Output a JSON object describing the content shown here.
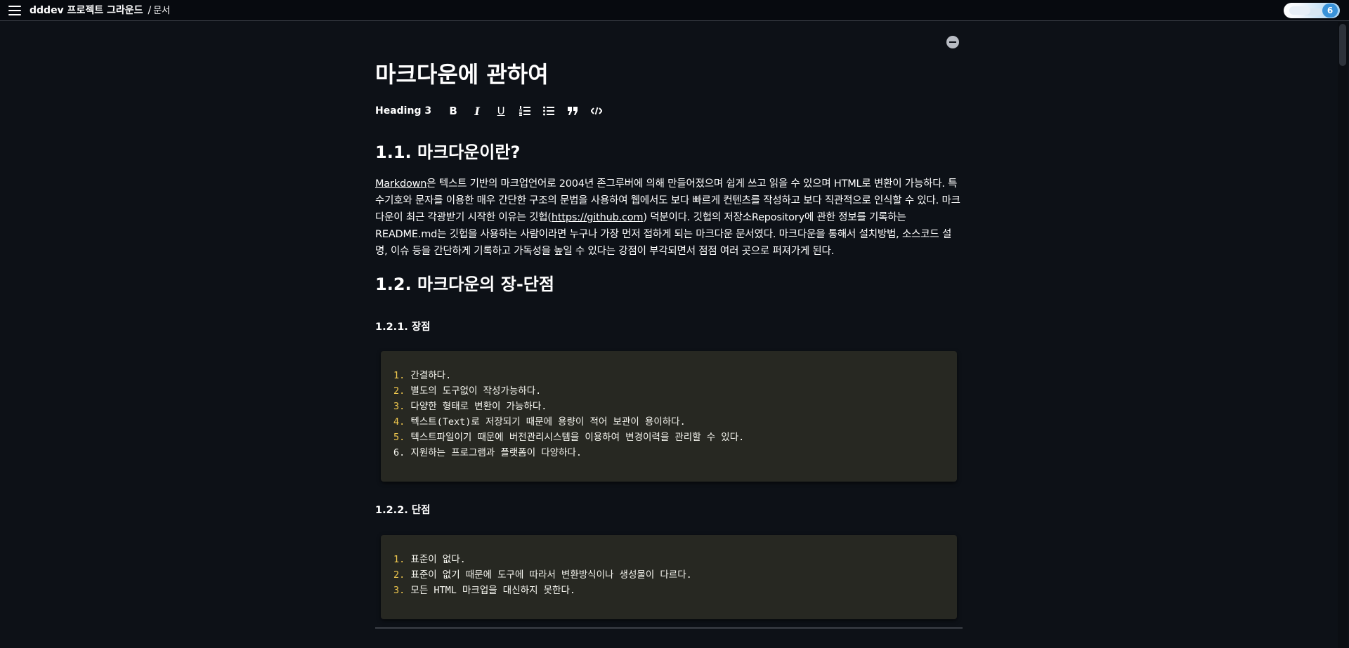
{
  "header": {
    "project": "dddev 프로젝트 그라운드",
    "separator": "/",
    "page": "문서",
    "menu_icon": "hamburger-menu-icon",
    "user_count": "6"
  },
  "doc": {
    "title": "마크다운에 관하여",
    "toolbar": {
      "heading_label": "Heading 3",
      "bold_label": "B",
      "italic_label": "I",
      "underline_label": "U",
      "icons": [
        "bold-icon",
        "italic-icon",
        "underline-icon",
        "ordered-list-icon",
        "bullet-list-icon",
        "quote-icon",
        "code-icon"
      ]
    },
    "section1": {
      "heading": "1.1. 마크다운이란?",
      "link_text": "Markdown",
      "text_a": "은 텍스트 기반의 마크업언어로 2004년 존그루버에 의해 만들어졌으며 쉽게 쓰고 읽을 수 있으며 HTML로 변환이 가능하다. 특수기호와 문자를 이용한 매우 간단한 구조의 문법을 사용하여 웹에서도 보다 빠르게 컨텐츠를 작성하고 보다 직관적으로 인식할 수 있다. 마크다운이 최근 각광받기 시작한 이유는 깃헙(",
      "github_link": "https://github.com",
      "text_b": ") 덕분이다. 깃헙의 저장소Repository에 관한 정보를 기록하는 README.md는 깃헙을 사용하는 사람이라면 누구나 가장 먼저 접하게 되는 마크다운 문서였다. 마크다운을 통해서 설치방법, 소스코드 설명, 이슈 등을 간단하게 기록하고 가독성을 높일 수 있다는 강점이 부각되면서 점점 여러 곳으로 퍼져가게 된다."
    },
    "section2": {
      "heading": "1.2. 마크다운의 장-단점",
      "pros_heading": "1.2.1. 장점",
      "pros": [
        {
          "num": "1.",
          "text": " 간결하다."
        },
        {
          "num": "2.",
          "text": " 별도의 도구없이 작성가능하다."
        },
        {
          "num": "3.",
          "text": " 다양한 형태로 변환이 가능하다."
        },
        {
          "num": "4.",
          "text": " 텍스트(Text)로 저장되기 때문에 용량이 적어 보관이 용이하다."
        },
        {
          "num": "5.",
          "text": " 텍스트파일이기 때문에 버전관리시스템을 이용하여 변경이력을 관리할 수 있다."
        },
        {
          "num": "6.",
          "text": " 지원하는 프로그램과 플랫폼이 다양하다."
        }
      ],
      "cons_heading": "1.2.2. 단점",
      "cons": [
        {
          "num": "1.",
          "text": " 표준이 없다."
        },
        {
          "num": "2.",
          "text": " 표준이 없기 때문에 도구에 따라서 변환방식이나 생성물이 다르다."
        },
        {
          "num": "3.",
          "text": " 모든 HTML 마크업을 대신하지 못한다."
        }
      ]
    }
  },
  "colors": {
    "background": "#0d1117",
    "topbar": "#070a0f",
    "code_background": "#272822",
    "code_number": "#f1c94e",
    "badge": "#3a93d9"
  }
}
